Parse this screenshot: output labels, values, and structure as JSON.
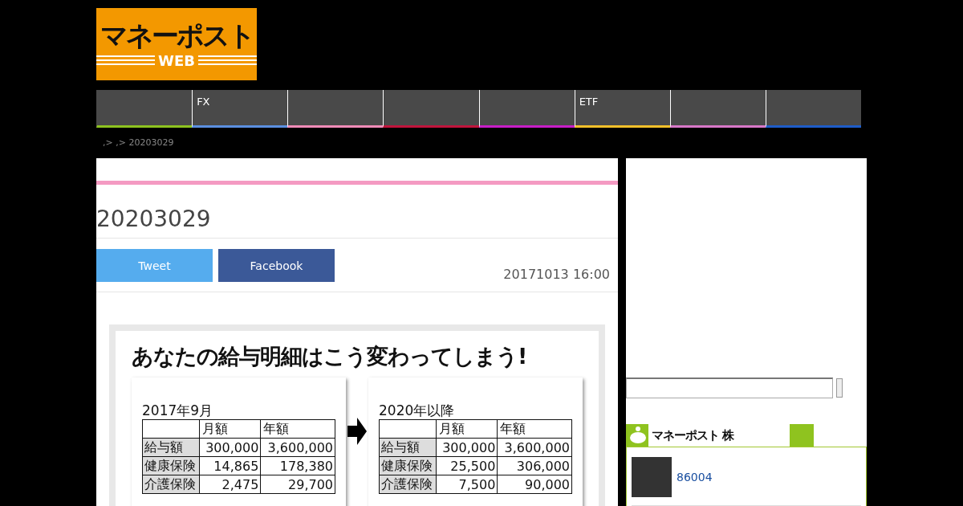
{
  "logo": {
    "title": "マネーポスト",
    "subtitle": "WEB"
  },
  "nav": [
    {
      "color": "#8dc21f"
    },
    {
      "label": "FX",
      "color": "#5b8fe0"
    },
    {
      "color": "#f08cb8"
    },
    {
      "color": "#c0143c"
    },
    {
      "color": "#c81ec8"
    },
    {
      "label": "ETF",
      "color": "#f5c02a"
    },
    {
      "color": "#d878c8"
    },
    {
      "color": "#1e5cc8"
    }
  ],
  "breadcrumb": ",> ,> 20203029",
  "article": {
    "title": "20203029",
    "buttons": [
      {
        "kind": "tweet",
        "label": "Tweet"
      },
      {
        "kind": "facebook",
        "label": "Facebook"
      }
    ],
    "date": "20171013 16:00",
    "figure": {
      "heading": "あなたの給与明細はこう変わってしまう!",
      "panels": [
        {
          "title": "2017年9月",
          "columns": [
            "月額",
            "年額"
          ],
          "rows": [
            {
              "label": "給与額",
              "values": [
                "300,000",
                "3,600,000"
              ]
            },
            {
              "label": "健康保険",
              "values": [
                "14,865",
                "178,380"
              ]
            },
            {
              "label": "介護保険",
              "values": [
                "2,475",
                "29,700"
              ]
            }
          ]
        },
        {
          "title": "2020年以降",
          "columns": [
            "月額",
            "年額"
          ],
          "rows": [
            {
              "label": "給与額",
              "values": [
                "300,000",
                "3,600,000"
              ]
            },
            {
              "label": "健康保険",
              "values": [
                "25,500",
                "306,000"
              ]
            },
            {
              "label": "介護保険",
              "values": [
                "7,500",
                "90,000"
              ]
            }
          ]
        }
      ]
    }
  },
  "sidebar": {
    "widget": {
      "title": "マネーポスト 株",
      "items": [
        {
          "link": "86004"
        }
      ]
    }
  }
}
